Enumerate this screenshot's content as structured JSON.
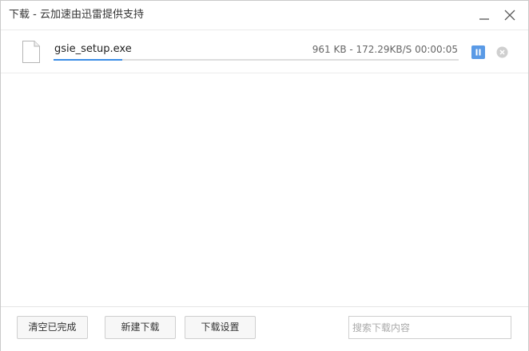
{
  "window": {
    "title": "下载 - 云加速由迅雷提供支持",
    "minimize_icon": "minimize-icon",
    "close_icon": "close-icon"
  },
  "downloads": [
    {
      "file_name": "gsie_setup.exe",
      "size": "961 KB",
      "speed": "172.29KB/S",
      "time_remaining": "00:00:05",
      "stats_text": "961 KB - 172.29KB/S 00:00:05",
      "progress": 0.17,
      "icon": "file-icon",
      "pause_icon": "pause-icon",
      "delete_icon": "delete-icon"
    }
  ],
  "footer": {
    "clear_completed_label": "清空已完成",
    "new_download_label": "新建下载",
    "download_settings_label": "下载设置",
    "search_placeholder": "搜索下载内容",
    "search_value": ""
  },
  "colors": {
    "accent": "#3b8de6",
    "pause_button": "#5a9ae6",
    "border": "#c9c9c9",
    "track": "#dedede"
  }
}
